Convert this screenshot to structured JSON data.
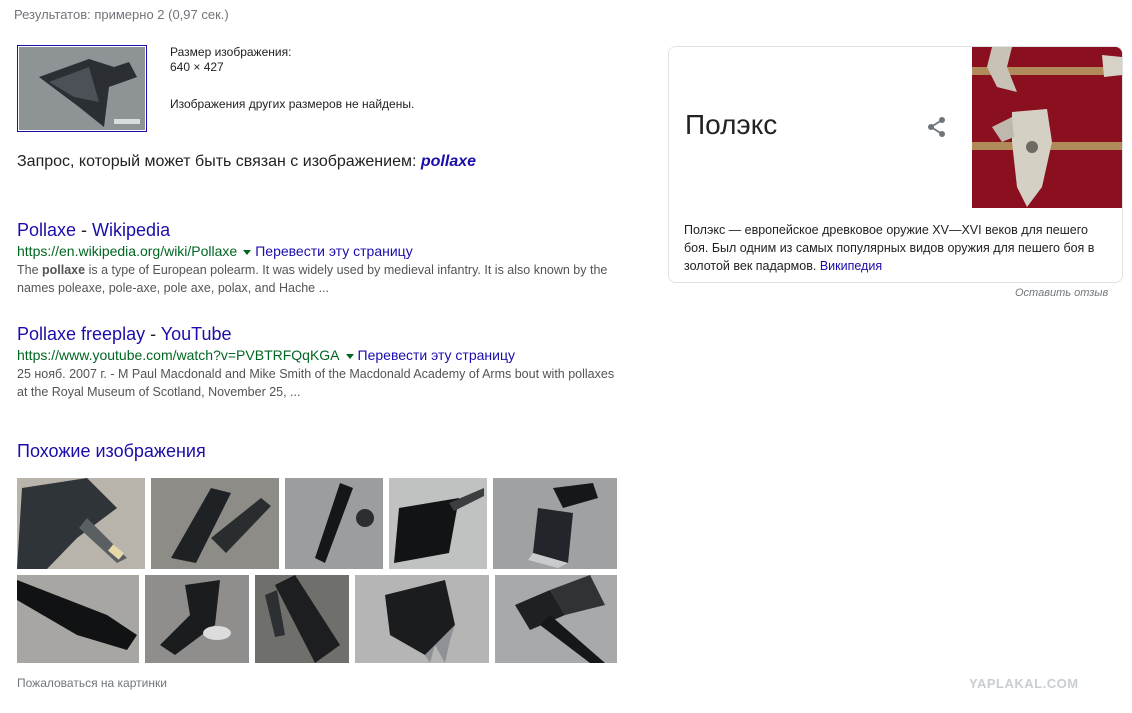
{
  "stats": "Результатов: примерно 2 (0,97 сек.)",
  "query_image": {
    "size_label": "Размер изображения:",
    "size_value": "640 × 427",
    "no_other_sizes": "Изображения других размеров не найдены."
  },
  "related_query": {
    "prefix": "Запрос, который может быть связан с изображением:",
    "term": "pollaxe"
  },
  "results": [
    {
      "title_a": "Pollaxe",
      "title_sep": " - ",
      "title_b": "Wikipedia",
      "url": "https://en.wikipedia.org/wiki/Pollaxe",
      "translate": "Перевести эту страницу",
      "snippet_pre": "The ",
      "snippet_bold": "pollaxe",
      "snippet_post": " is a type of European polearm. It was widely used by medieval infantry. It is also known by the names poleaxe, pole-axe, pole axe, polax, and Hache ..."
    },
    {
      "title_a": "Pollaxe freeplay",
      "title_sep": " - ",
      "title_b": "YouTube",
      "url": "https://www.youtube.com/watch?v=PVBTRFQqKGA",
      "translate": "Перевести эту страницу",
      "snippet_pre": "25 нояб. 2007 г. - M Paul Macdonald and Mike Smith of the Macdonald Academy of Arms bout with pollaxes at the Royal Museum of Scotland, November 25, ...",
      "snippet_bold": "",
      "snippet_post": ""
    }
  ],
  "similar": {
    "title": "Похожие изображения",
    "report": "Пожаловаться на картинки"
  },
  "knowledge_panel": {
    "title": "Полэкс",
    "share_icon": "share-icon",
    "description": "Полэкс — европейское древковое оружие XV—XVI веков для пешего боя. Был одним из самых популярных видов оружия для пешего боя в золотой век падармов. ",
    "source": "Википедия",
    "feedback": "Оставить отзыв"
  },
  "watermark": "YAPLAKAL.COM",
  "colors": {
    "link": "#1a0dab",
    "url_green": "#006621",
    "snippet_gray": "#545454",
    "panel_red": "#8c1020"
  }
}
